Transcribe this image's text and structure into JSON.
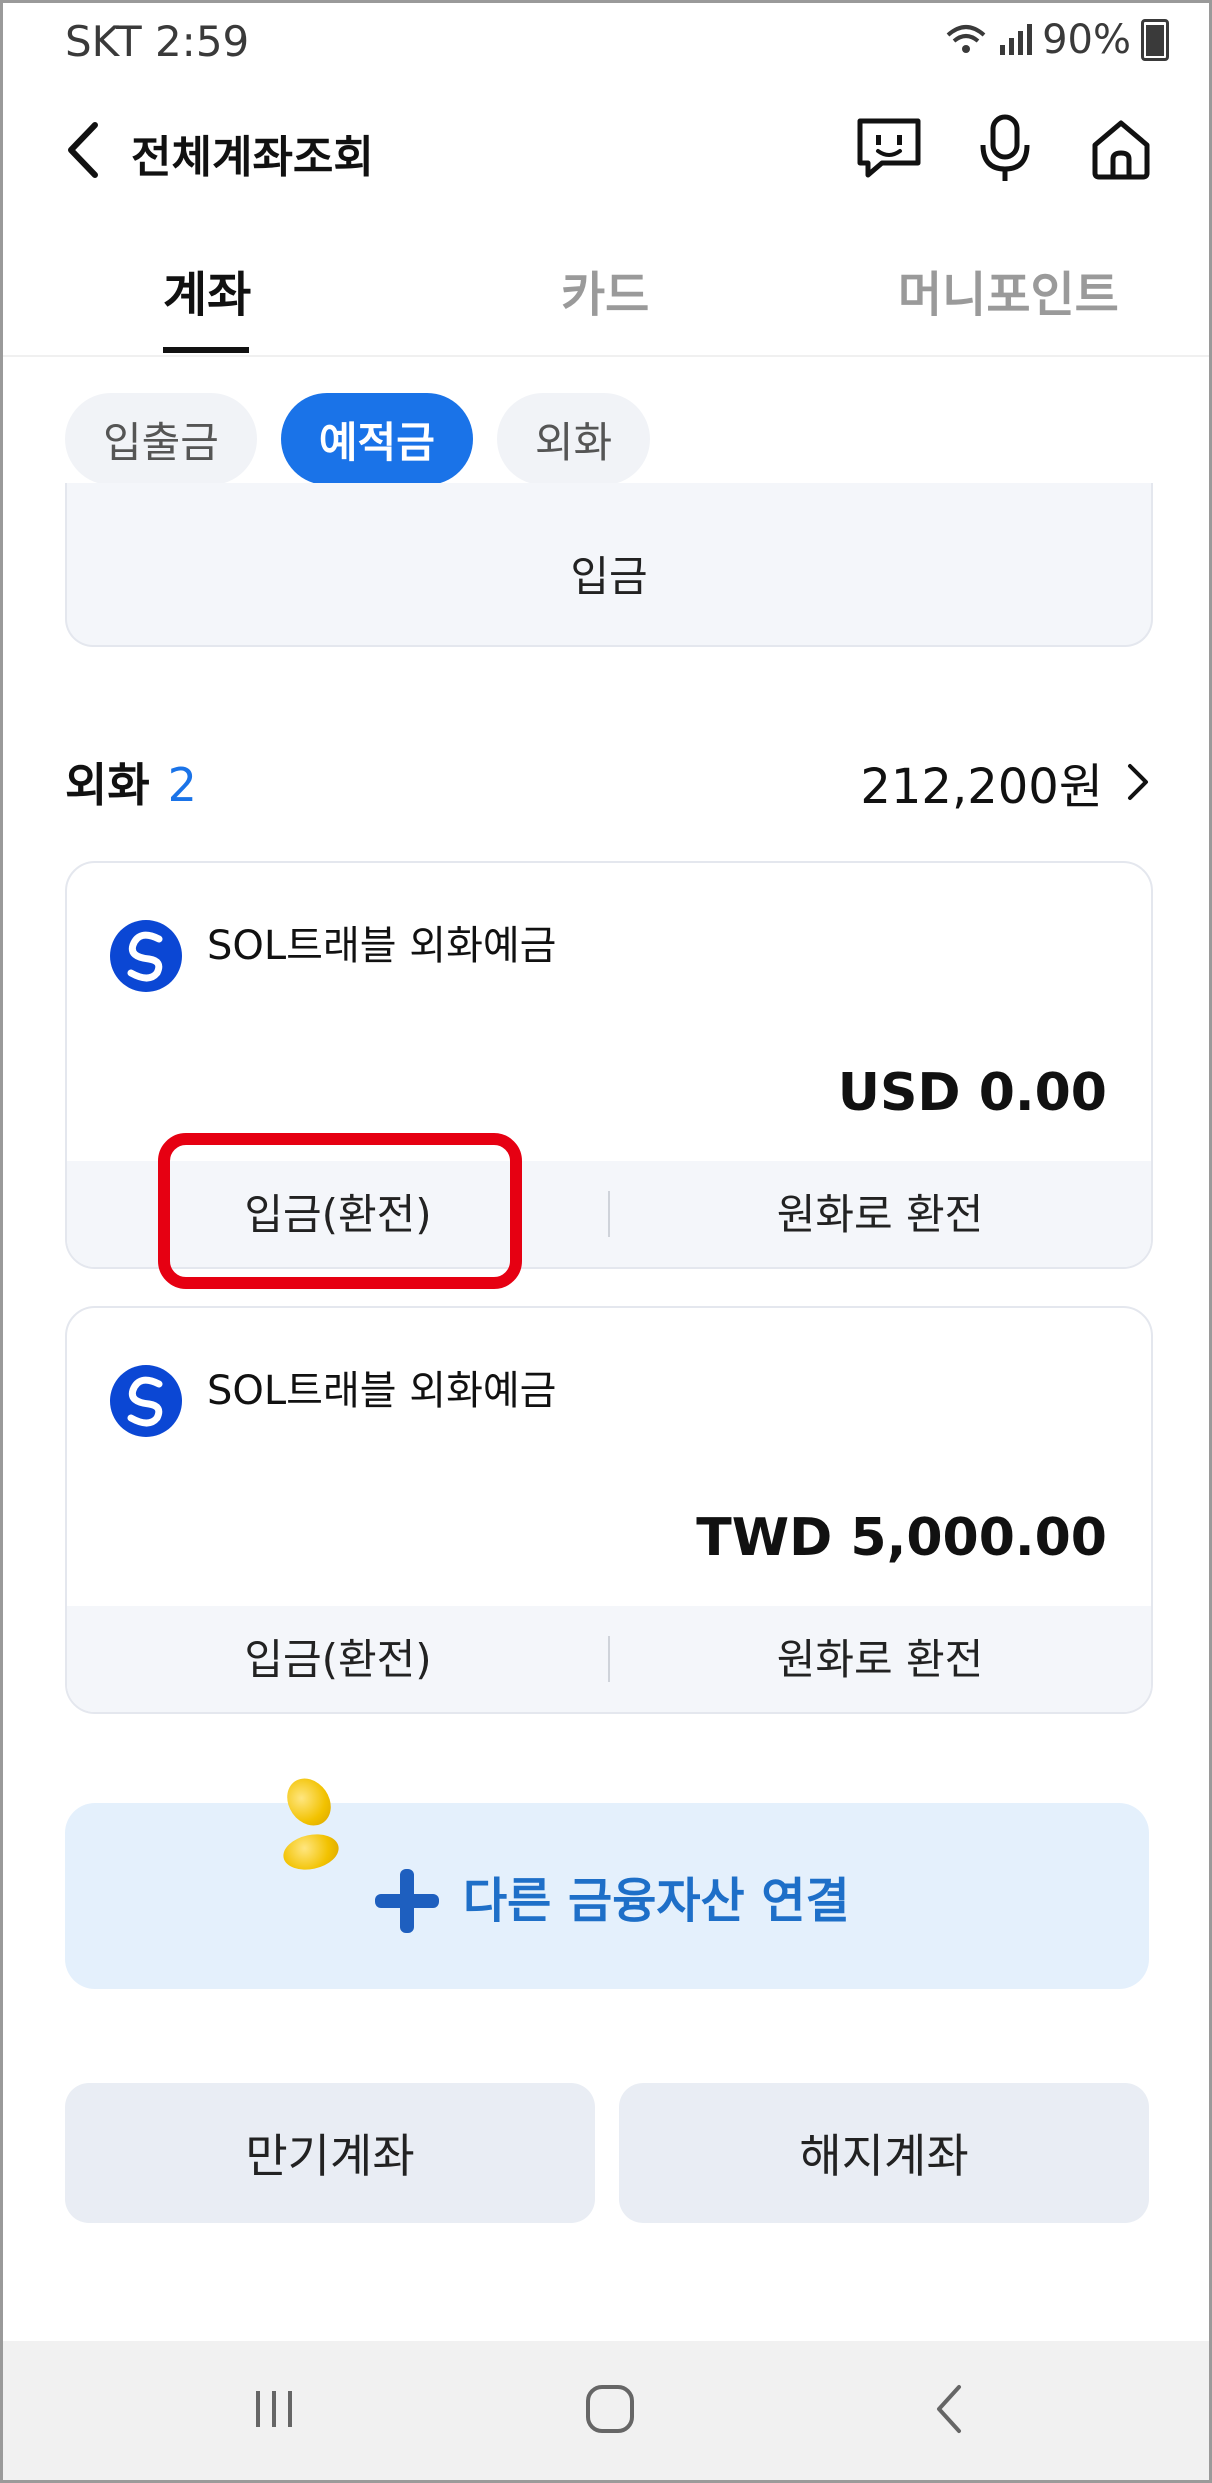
{
  "status_bar": {
    "carrier_time": "SKT 2:59",
    "battery": "90%",
    "icons": [
      "wifi-icon",
      "signal-icon",
      "battery-icon"
    ]
  },
  "header": {
    "title": "전체계좌조회",
    "icons": [
      "back-icon",
      "chatbot-icon",
      "microphone-icon",
      "home-icon"
    ]
  },
  "tabs": [
    {
      "label": "계좌",
      "active": true
    },
    {
      "label": "카드",
      "active": false
    },
    {
      "label": "머니포인트",
      "active": false
    }
  ],
  "chips": [
    {
      "label": "입출금",
      "active": false
    },
    {
      "label": "예적금",
      "active": true
    },
    {
      "label": "외화",
      "active": false
    }
  ],
  "partial_card": {
    "button_label": "입금"
  },
  "section": {
    "title": "외화",
    "count": "2",
    "total": "212,200원"
  },
  "cards": [
    {
      "name": "SOL트래블 외화예금",
      "amount": "USD 0.00",
      "action_left": "입금(환전)",
      "action_right": "원화로 환전"
    },
    {
      "name": "SOL트래블 외화예금",
      "amount": "TWD 5,000.00",
      "action_left": "입금(환전)",
      "action_right": "원화로 환전"
    }
  ],
  "connect_banner": {
    "label": "다른 금융자산 연결"
  },
  "bottom_buttons": {
    "matured": "만기계좌",
    "closed": "해지계좌"
  },
  "colors": {
    "accent": "#1a73e8",
    "highlight": "#e60012",
    "banner_bg": "#e4f0fc",
    "banner_text": "#1e6fc8"
  }
}
